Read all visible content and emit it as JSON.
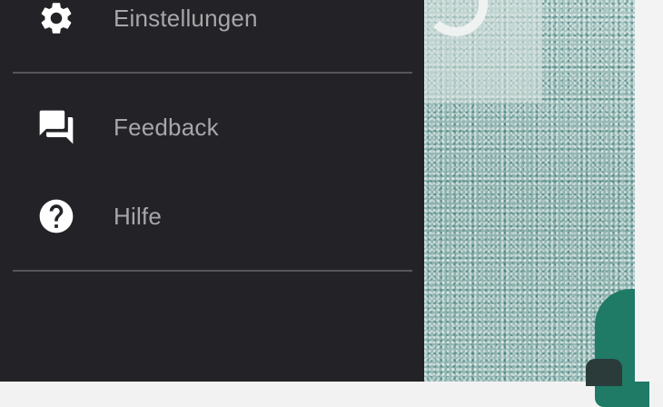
{
  "drawer": {
    "items": [
      {
        "label": "Einstellungen",
        "icon": "gear-icon"
      },
      {
        "label": "Feedback",
        "icon": "feedback-icon"
      },
      {
        "label": "Hilfe",
        "icon": "help-icon"
      }
    ]
  },
  "colors": {
    "drawer_background": "#232226",
    "label": "#a7a7aa",
    "icon": "#ffffff",
    "divider": "#56555a"
  }
}
